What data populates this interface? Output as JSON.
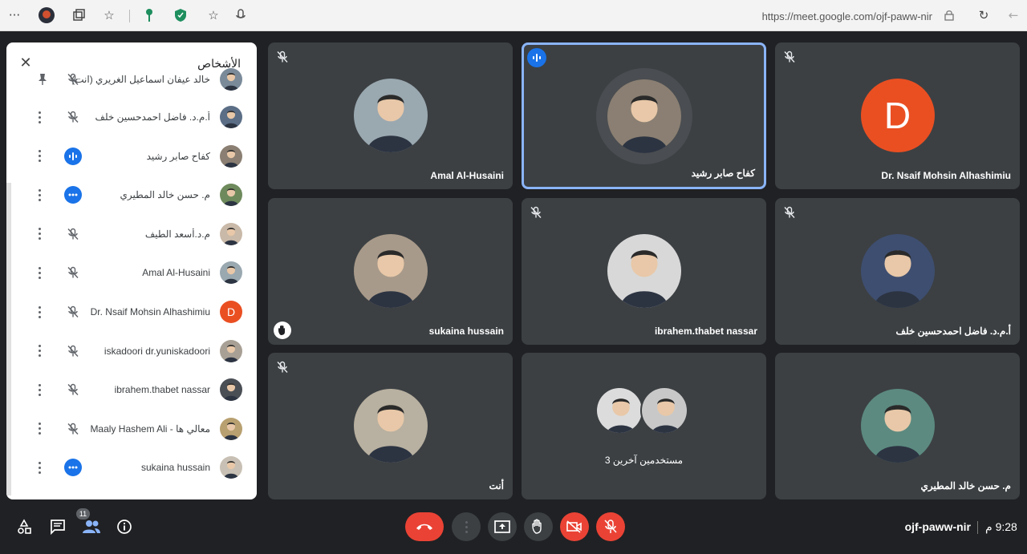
{
  "browser": {
    "url": "https://meet.google.com/ojf-paww-nir",
    "menu_icon": "more-horizontal-icon"
  },
  "panel": {
    "title": "الأشخاص",
    "people": [
      {
        "name": "خالد عيفان اسماعيل الغريري (انت)",
        "status": "pin",
        "avatar_color": "#7a8a99"
      },
      {
        "name": "أ.م.د. فاضل احمدحسين خلف",
        "status": "muted",
        "avatar_color": "#5b6e86"
      },
      {
        "name": "كفاح صابر رشيد",
        "status": "speaking",
        "avatar_color": "#8a7f72"
      },
      {
        "name": "م. حسن خالد المطيري",
        "status": "more",
        "avatar_color": "#6e8a5c"
      },
      {
        "name": "م.د.أسعد الطيف",
        "status": "muted",
        "avatar_color": "#c9b9a8"
      },
      {
        "name": "Amal Al-Husaini",
        "status": "muted",
        "avatar_color": "#9aa8b0"
      },
      {
        "name": "Dr. Nsaif Mohsin Alhashimiu",
        "status": "muted",
        "avatar_color": "#ea4f22",
        "letter": "D"
      },
      {
        "name": "iskadoori dr.yuniskadoori",
        "status": "muted",
        "avatar_color": "#a8a095"
      },
      {
        "name": "ibrahem.thabet nassar",
        "status": "muted",
        "avatar_color": "#4a4f55"
      },
      {
        "name": "Maaly Hashem Ali - معالي ها",
        "status": "muted",
        "avatar_color": "#b8a070"
      },
      {
        "name": "sukaina hussain",
        "status": "more",
        "avatar_color": "#c8c0b4"
      }
    ]
  },
  "tiles": [
    {
      "name": "Dr. Nsaif Mohsin Alhashimiu",
      "letter": "D",
      "muted": true,
      "active": false,
      "avatar_color": "#ea4f22"
    },
    {
      "name": "كفاح صابر رشيد",
      "muted": false,
      "speaking": true,
      "active": true,
      "avatar_color": "#8a7f72"
    },
    {
      "name": "Amal Al-Husaini",
      "muted": true,
      "active": false,
      "avatar_color": "#9aa8b0"
    },
    {
      "name": "أ.م.د. فاضل احمدحسين خلف",
      "muted": true,
      "active": false,
      "avatar_color": "#3e4e70"
    },
    {
      "name": "ibrahem.thabet nassar",
      "muted": true,
      "active": false,
      "avatar_color": "#d8d8d8"
    },
    {
      "name": "sukaina hussain",
      "muted": false,
      "hand_raised": true,
      "active": false,
      "avatar_color": "#a89a8a"
    },
    {
      "name": "م. حسن خالد المطيري",
      "muted": false,
      "active": false,
      "avatar_color": "#5c8a80"
    },
    {
      "name": "3 مستخدمين آخرين",
      "muted": false,
      "group": true,
      "active": false,
      "avatar_color": "#d0d0d0"
    },
    {
      "name": "أنت",
      "muted": true,
      "active": false,
      "avatar_color": "#b8b0a0"
    }
  ],
  "footer": {
    "meeting_code": "ojf-paww-nir",
    "time": "9:28 م",
    "people_count": "11",
    "colors": {
      "end_call": "#ea4335",
      "muted_red": "#ea4335",
      "dark_button": "#3c4043"
    }
  }
}
